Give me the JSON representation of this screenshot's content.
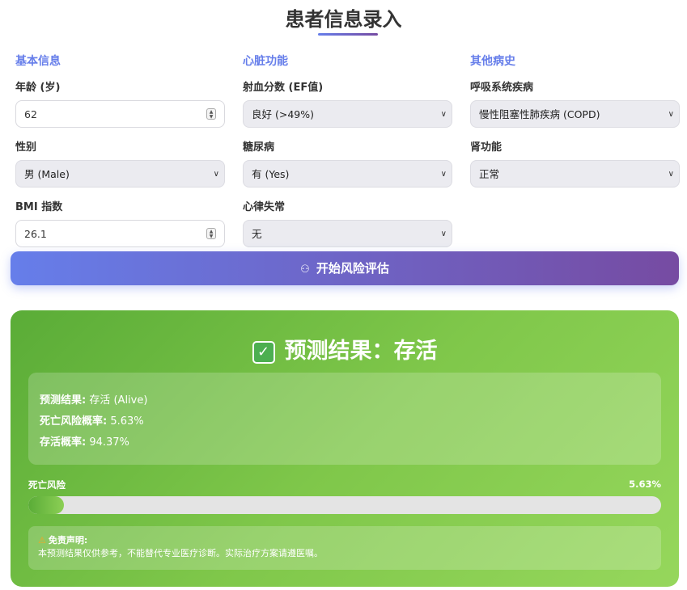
{
  "page_title": "患者信息录入",
  "sections": {
    "basic": {
      "heading": "基本信息",
      "age_label": "年龄 (岁)",
      "age_value": "62",
      "sex_label": "性别",
      "sex_value": "男 (Male)",
      "bmi_label": "BMI 指数",
      "bmi_value": "26.1"
    },
    "cardiac": {
      "heading": "心脏功能",
      "ef_label": "射血分数 (EF值)",
      "ef_value": "良好 (>49%)",
      "diabetes_label": "糖尿病",
      "diabetes_value": "有 (Yes)",
      "arrhythmia_label": "心律失常",
      "arrhythmia_value": "无"
    },
    "other": {
      "heading": "其他病史",
      "resp_label": "呼吸系统疾病",
      "resp_value": "慢性阻塞性肺疾病 (COPD)",
      "kidney_label": "肾功能",
      "kidney_value": "正常"
    }
  },
  "button": {
    "icon": "robot-icon",
    "label": "开始风险评估"
  },
  "result": {
    "title": "预测结果：存活",
    "prediction_label": "预测结果:",
    "prediction_value": "存活 (Alive)",
    "death_prob_label": "死亡风险概率:",
    "death_prob_value": "5.63%",
    "survival_prob_label": "存活概率:",
    "survival_prob_value": "94.37%",
    "risk_bar_label": "死亡风险",
    "risk_bar_value": "5.63%",
    "risk_fraction": 0.0563,
    "disclaimer_title": "免责声明:",
    "disclaimer_text": "本预测结果仅供参考，不能替代专业医疗诊断。实际治疗方案请遵医嘱。"
  },
  "colors": {
    "accent": "#667eea",
    "accent2": "#764ba2",
    "success": "#5aac37"
  }
}
